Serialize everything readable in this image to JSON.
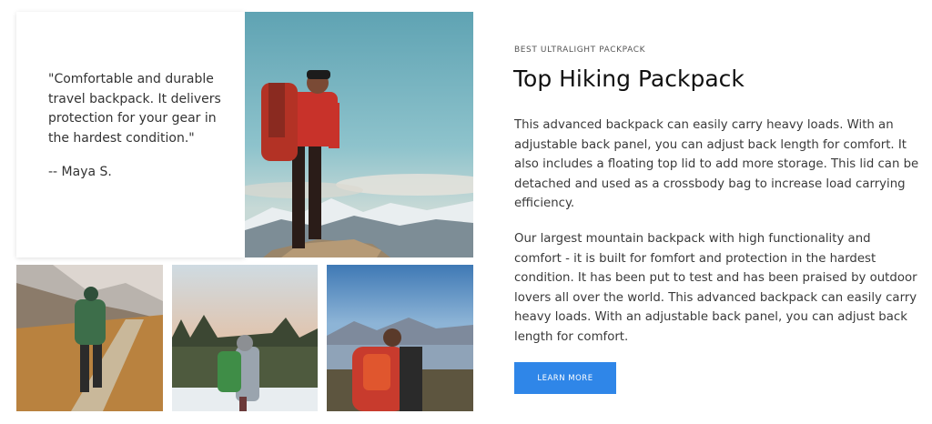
{
  "testimonial": {
    "quote": "\"Comfortable and durable travel backpack. It delivers protection for your gear in the hardest condition.\"",
    "author": "-- Maya S."
  },
  "images": {
    "hero": "Hiker in red jacket with red backpack on mountain summit",
    "thumb1": "Hiker with green backpack walking mountain trail",
    "thumb2": "Hiker with green backpack in snowy forest at sunset",
    "thumb3": "Hiker with red backpack overlooking lake and mountains"
  },
  "product": {
    "eyebrow": "BEST ULTRALIGHT PACKPACK",
    "title": "Top Hiking Packpack",
    "paragraph1": "This advanced backpack can easily carry heavy loads. With an adjustable back panel, you can adjust back length for comfort. It also includes a floating top lid to add more storage. This lid can be detached and used as a crossbody bag to increase load carrying efficiency.",
    "paragraph2": "Our largest mountain backpack with high functionality and comfort - it is built for fomfort and protection in the hardest condition. It has been put to test and has been praised by outdoor lovers all over the world. This advanced backpack can easily carry heavy loads. With an adjustable back panel, you can adjust back length for comfort.",
    "button_label": "LEARN MORE"
  },
  "colors": {
    "accent": "#2f86e8",
    "title": "#111111",
    "body_text": "#3a3a3a"
  }
}
